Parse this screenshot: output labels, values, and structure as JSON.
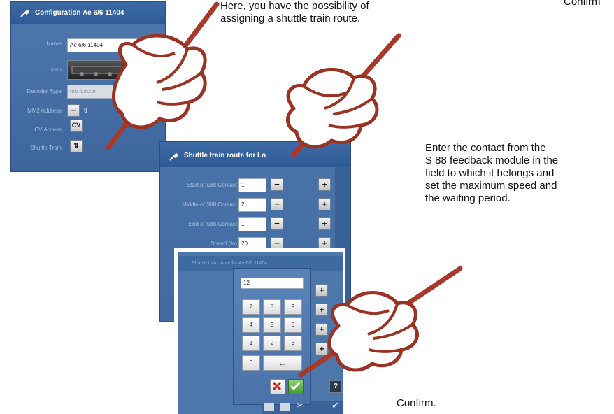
{
  "captions": {
    "top": "Here, you have the possibility of\nassigning a shuttle train route.",
    "right": "Enter the contact from the\nS 88 feedback module in the\nfield to which it belongs and\nset the maximum speed and\nthe waiting period.",
    "confirm": "Confirm.",
    "top_right_fragment": "Confirm"
  },
  "config_dialog": {
    "title": "Configuration Ae 6/6 11404",
    "fields": [
      {
        "label": "Name",
        "value": "Ae 6/6 11404"
      },
      {
        "label": "Icon",
        "value": ""
      },
      {
        "label": "Decoder Type",
        "value": "mfx Locom"
      },
      {
        "label": "MM2 Address",
        "value": "9"
      },
      {
        "label": "CV Access",
        "value": ""
      },
      {
        "label": "Shuttle Train",
        "value": ""
      }
    ],
    "dots_button": "..."
  },
  "shuttle_dialog": {
    "title": "Shuttle train route for Lo",
    "rows": [
      {
        "label": "Start of S88 Contact",
        "value": "1"
      },
      {
        "label": "Middle of S88 Contact",
        "value": "2"
      },
      {
        "label": "End of S88 Contact",
        "value": "1"
      },
      {
        "label": "Speed (%)",
        "value": "20"
      }
    ],
    "minus": "−",
    "plus": "+"
  },
  "keypad_dialog": {
    "title": "Shuttle train route for Ae 6/6 11404",
    "display": "12",
    "keys": [
      "7",
      "8",
      "9",
      "4",
      "5",
      "6",
      "1",
      "2",
      "3",
      "0",
      "←"
    ],
    "help": "?"
  },
  "colors": {
    "dialog_blue": "#4a74aa",
    "title_blue": "#2f5b95",
    "hand_outline": "#9a3324",
    "pen": "#a8382a",
    "cancel_red": "#d11a1a",
    "ok_green": "#4caf3a"
  }
}
